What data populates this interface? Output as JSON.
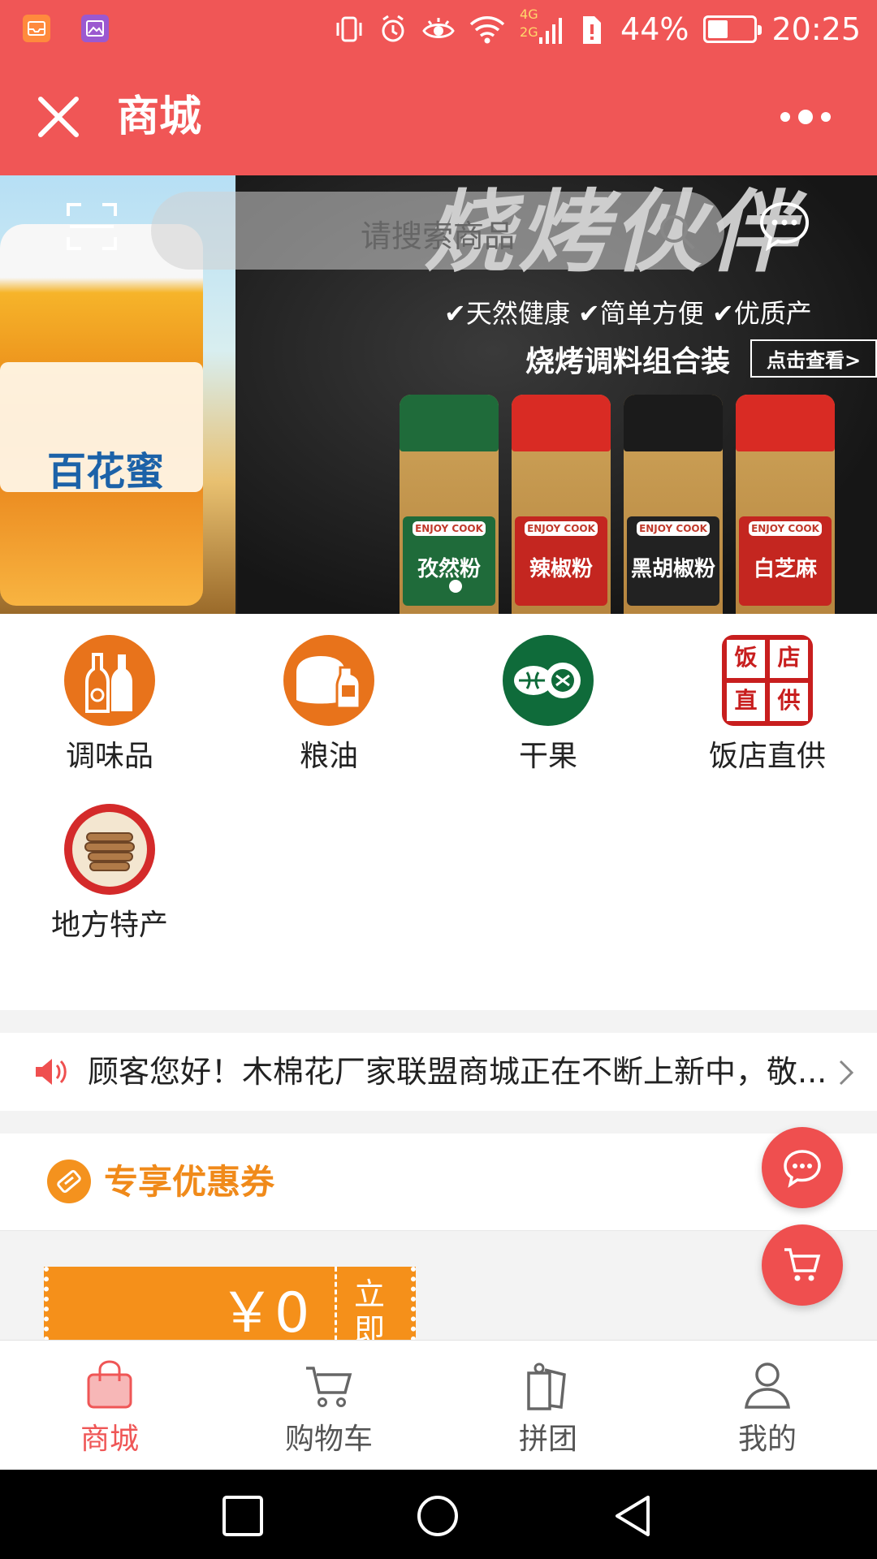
{
  "status_bar": {
    "battery": "44%",
    "battery_level": 0.44,
    "time": "20:25",
    "network_labels": [
      "4G",
      "2G"
    ]
  },
  "header": {
    "title": "商城"
  },
  "search": {
    "placeholder": "请搜索商品"
  },
  "banner": {
    "left_slide_text": "百花蜜",
    "headline": "烧烤伙伴",
    "features": "✔天然健康 ✔简单方便 ✔优质产",
    "subtitle": "烧烤调料组合装",
    "cta": "点击查看>",
    "jars": [
      {
        "brand": "ENJOY COOK",
        "name": "孜然粉",
        "cap_color": "#1f6b3a",
        "label_color": "#1f6b3a"
      },
      {
        "brand": "ENJOY COOK",
        "name": "辣椒粉",
        "cap_color": "#d92b24",
        "label_color": "#c42620"
      },
      {
        "brand": "ENJOY COOK",
        "name": "黑胡椒粉",
        "cap_color": "#1b1b1b",
        "label_color": "#222222"
      },
      {
        "brand": "ENJOY COOK",
        "name": "白芝麻",
        "cap_color": "#d92b24",
        "label_color": "#c42620"
      }
    ]
  },
  "categories": [
    {
      "label": "调味品",
      "icon": "bottles-icon",
      "color": "#e8731b"
    },
    {
      "label": "粮油",
      "icon": "rice-oil-icon",
      "color": "#e8731b"
    },
    {
      "label": "干果",
      "icon": "nuts-icon",
      "color": "#0f6b3a"
    },
    {
      "label": "饭店直供",
      "icon": "restaurant-stamp-icon",
      "color": "#c81e1e",
      "stamp_chars": [
        "饭",
        "店",
        "直",
        "供"
      ]
    },
    {
      "label": "地方特产",
      "icon": "local-specialty-icon",
      "color": "#d42a2a"
    }
  ],
  "notice": {
    "text": "顾客您好！木棉花厂家联盟商城正在不断上新中，敬..."
  },
  "coupons": {
    "section_title": "专享优惠券",
    "items": [
      {
        "amount": "￥0",
        "action": "立即"
      }
    ]
  },
  "tabs": [
    {
      "label": "商城",
      "icon": "shopping-bag-icon",
      "active": true
    },
    {
      "label": "购物车",
      "icon": "cart-icon",
      "active": false
    },
    {
      "label": "拼团",
      "icon": "group-buy-tag-icon",
      "active": false
    },
    {
      "label": "我的",
      "icon": "user-icon",
      "active": false
    }
  ],
  "colors": {
    "brand_red": "#f05656",
    "coupon_orange": "#f5901a",
    "active_tab": "#ef5656"
  }
}
